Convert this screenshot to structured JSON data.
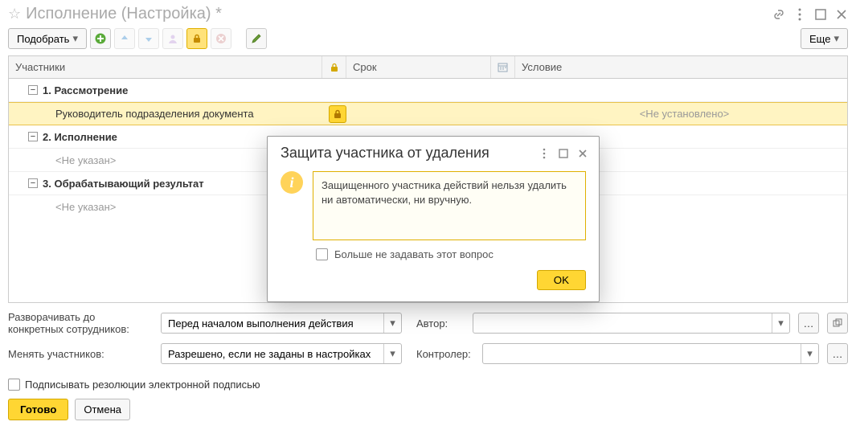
{
  "title": "Исполнение (Настройка) *",
  "toolbar": {
    "pick": "Подобрать",
    "more": "Еще"
  },
  "grid": {
    "headers": {
      "participants": "Участники",
      "deadline": "Срок",
      "condition": "Условие"
    },
    "rows": [
      {
        "type": "group",
        "label": "1. Рассмотрение"
      },
      {
        "type": "selected",
        "label": "Руководитель подразделения документа",
        "condition": "<Не установлено>"
      },
      {
        "type": "group",
        "label": "2. Исполнение"
      },
      {
        "type": "item",
        "label": "<Не указан>"
      },
      {
        "type": "group",
        "label": "3. Обрабатывающий результат"
      },
      {
        "type": "item",
        "label": "<Не указан>"
      }
    ]
  },
  "form": {
    "expand_label": "Разворачивать до конкретных сотрудников:",
    "expand_value": "Перед началом выполнения действия",
    "author_label": "Автор:",
    "change_label": "Менять участников:",
    "change_value": "Разрешено, если не заданы в настройках",
    "controller_label": "Контролер:",
    "sign_label": "Подписывать резолюции электронной подписью"
  },
  "footer": {
    "done": "Готово",
    "cancel": "Отмена"
  },
  "modal": {
    "title": "Защита участника от удаления",
    "body": "Защищенного участника действий нельзя удалить ни автоматически, ни вручную.",
    "dont_ask": "Больше не задавать этот вопрос",
    "ok": "OK"
  }
}
